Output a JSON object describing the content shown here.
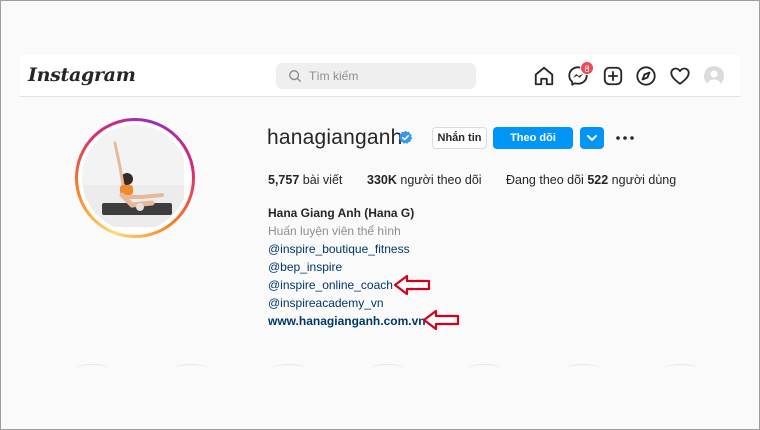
{
  "header": {
    "logo": "Instagram",
    "search_placeholder": "Tìm kiếm",
    "icons": [
      "home-icon",
      "messenger-icon",
      "new-post-icon",
      "explore-icon",
      "activity-heart-icon",
      "profile-avatar"
    ],
    "messenger_badge": "8"
  },
  "profile": {
    "username": "hanagianganh",
    "verified": true,
    "message_button": "Nhắn tin",
    "follow_button": "Theo dõi",
    "stats": {
      "posts_count": "5,757",
      "posts_label": "bài viết",
      "followers_count": "330K",
      "followers_label": "người theo dõi",
      "following_prefix": "Đang theo dõi",
      "following_count": "522",
      "following_label": "người dùng"
    },
    "bio": {
      "full_name": "Hana Giang Anh (Hana G)",
      "category": "Huấn luyện viên thể hình",
      "mentions": [
        "@inspire_boutique_fitness",
        "@bep_inspire",
        "@inspire_online_coach",
        "@inspireacademy_vn"
      ],
      "website": "www.hanagianganh.com.vn"
    }
  },
  "colors": {
    "accent": "#0095f6",
    "link": "#00376b",
    "badge": "#ed4956",
    "annotation_arrow": "#d0021b"
  }
}
